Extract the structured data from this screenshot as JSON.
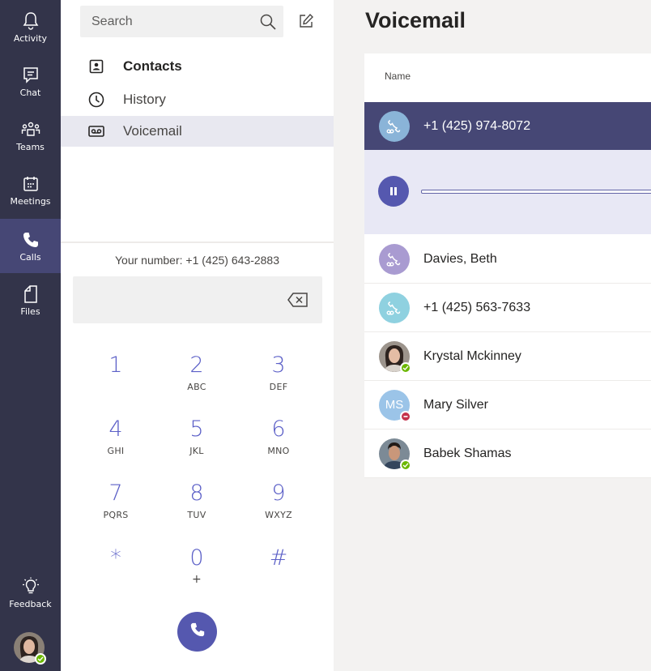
{
  "rail": {
    "items": [
      {
        "label": "Activity",
        "icon": "bell-icon"
      },
      {
        "label": "Chat",
        "icon": "chat-icon"
      },
      {
        "label": "Teams",
        "icon": "teams-icon"
      },
      {
        "label": "Meetings",
        "icon": "calendar-icon"
      },
      {
        "label": "Calls",
        "icon": "phone-icon",
        "active": true
      },
      {
        "label": "Files",
        "icon": "file-icon"
      }
    ],
    "feedback": {
      "label": "Feedback",
      "icon": "lightbulb-icon"
    },
    "user_status": "available"
  },
  "left_pane": {
    "search": {
      "placeholder": "Search"
    },
    "nav": [
      {
        "label": "Contacts",
        "icon": "contacts-icon"
      },
      {
        "label": "History",
        "icon": "clock-icon"
      },
      {
        "label": "Voicemail",
        "icon": "voicemail-icon",
        "active": true
      }
    ],
    "your_number": "Your number: +1 (425) 643-2883",
    "dialpad": [
      {
        "digit": "1",
        "letters": ""
      },
      {
        "digit": "2",
        "letters": "ABC"
      },
      {
        "digit": "3",
        "letters": "DEF"
      },
      {
        "digit": "4",
        "letters": "GHI"
      },
      {
        "digit": "5",
        "letters": "JKL"
      },
      {
        "digit": "6",
        "letters": "MNO"
      },
      {
        "digit": "7",
        "letters": "PQRS"
      },
      {
        "digit": "8",
        "letters": "TUV"
      },
      {
        "digit": "9",
        "letters": "WXYZ"
      },
      {
        "digit": "*",
        "letters": ""
      },
      {
        "digit": "0",
        "letters": "+"
      },
      {
        "digit": "#",
        "letters": ""
      }
    ]
  },
  "main": {
    "title": "Voicemail",
    "column_header": "Name",
    "player": {
      "state": "playing"
    },
    "rows": [
      {
        "name": "+1 (425) 974-8072",
        "avatar": "voicemail-phone",
        "selected": true
      },
      {
        "name": "Davies, Beth",
        "avatar": "voicemail-phone"
      },
      {
        "name": "+1 (425) 563-7633",
        "avatar": "voicemail-phone"
      },
      {
        "name": "Krystal Mckinney",
        "avatar": "photo",
        "status": "available"
      },
      {
        "name": "Mary Silver",
        "avatar": "initials",
        "initials": "MS",
        "status": "do-not-disturb"
      },
      {
        "name": "Babek Shamas",
        "avatar": "photo",
        "status": "available"
      }
    ]
  },
  "colors": {
    "rail_bg": "#33344a",
    "rail_active": "#464775",
    "accent": "#5558af",
    "selected_row": "#464775",
    "player_bg": "#e8e8f5",
    "available": "#6bb700",
    "dnd": "#c4314b"
  }
}
